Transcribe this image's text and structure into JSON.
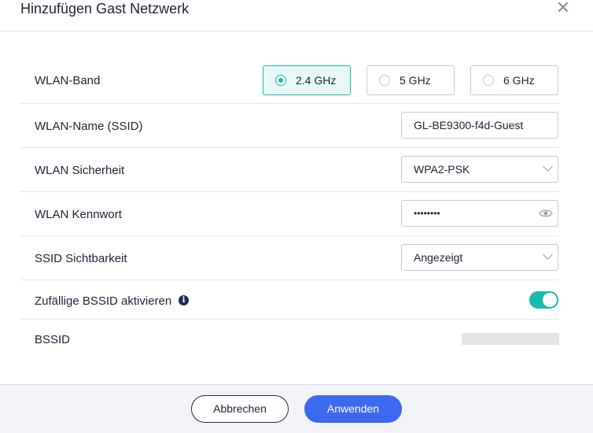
{
  "dialog": {
    "title": "Hinzufügen Gast Netzwerk",
    "close_icon": "close-icon"
  },
  "wlan_band": {
    "label": "WLAN-Band",
    "options": [
      {
        "label": "2.4 GHz",
        "selected": true
      },
      {
        "label": "5 GHz",
        "selected": false
      },
      {
        "label": "6 GHz",
        "selected": false
      }
    ]
  },
  "ssid": {
    "label": "WLAN-Name (SSID)",
    "value": "GL-BE9300-f4d-Guest"
  },
  "security": {
    "label": "WLAN Sicherheit",
    "value": "WPA2-PSK"
  },
  "password": {
    "label": "WLAN Kennwort",
    "value": "••••••••",
    "icon": "eye-icon"
  },
  "visibility": {
    "label": "SSID Sichtbarkeit",
    "value": "Angezeigt"
  },
  "random_bssid": {
    "label": "Zufällige BSSID aktivieren",
    "info_icon": "info-icon",
    "enabled": true
  },
  "bssid": {
    "label": "BSSID"
  },
  "footer": {
    "cancel_label": "Abbrechen",
    "apply_label": "Anwenden"
  },
  "colors": {
    "accent_teal": "#16bcae",
    "primary_blue": "#3c68f0",
    "text": "#1f2235"
  }
}
